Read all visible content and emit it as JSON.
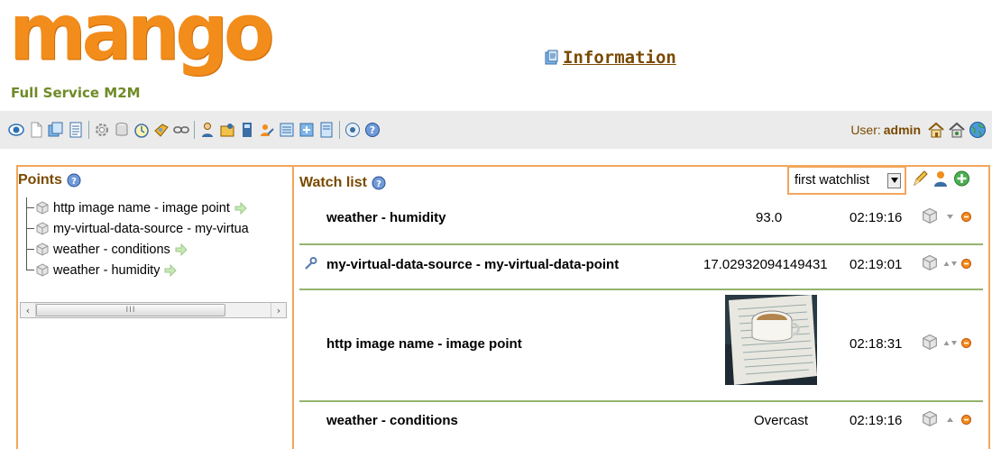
{
  "header": {
    "logo_word": "mango",
    "logo_tagline": "Full Service M2M",
    "info_link": "Information"
  },
  "toolbar": {
    "icons": [
      "watch-list-icon",
      "graphic-views-icon",
      "events-icon",
      "reports-icon",
      "data-sources-icon",
      "database-icon",
      "scheduled-events-icon",
      "event-handlers-icon",
      "point-links-icon",
      "users-icon",
      "user-profiles-icon",
      "point-hierarchy-icon",
      "mailing-lists-icon",
      "publishers-icon",
      "system-settings-icon",
      "sql-icon",
      "emport-icon",
      "help-icon"
    ],
    "user_label": "User:",
    "user_name": "admin"
  },
  "points": {
    "title": "Points",
    "items": [
      {
        "label": "http image name - image point"
      },
      {
        "label": "my-virtual-data-source - my-virtua"
      },
      {
        "label": "weather - conditions"
      },
      {
        "label": "weather - humidity"
      }
    ],
    "scroll_glyph": "III"
  },
  "watchlist": {
    "title": "Watch list",
    "selected": "first watchlist",
    "rows": [
      {
        "name": "weather - humidity",
        "value": "93.0",
        "time": "02:19:16"
      },
      {
        "name": "my-virtual-data-source - my-virtual-data-point",
        "value": "17.02932094149431",
        "time": "02:19:01"
      },
      {
        "name": "http image name - image point",
        "value": "",
        "time": "02:18:31"
      },
      {
        "name": "weather - conditions",
        "value": "Overcast",
        "time": "02:19:16"
      }
    ]
  },
  "colors": {
    "brand_orange": "#f28c1b",
    "tagline_green": "#6f8b27",
    "title_brown": "#7a4a00",
    "panel_border": "#f2a65c",
    "row_divider": "#93b46e",
    "toolbar_bg": "#ebebeb"
  }
}
